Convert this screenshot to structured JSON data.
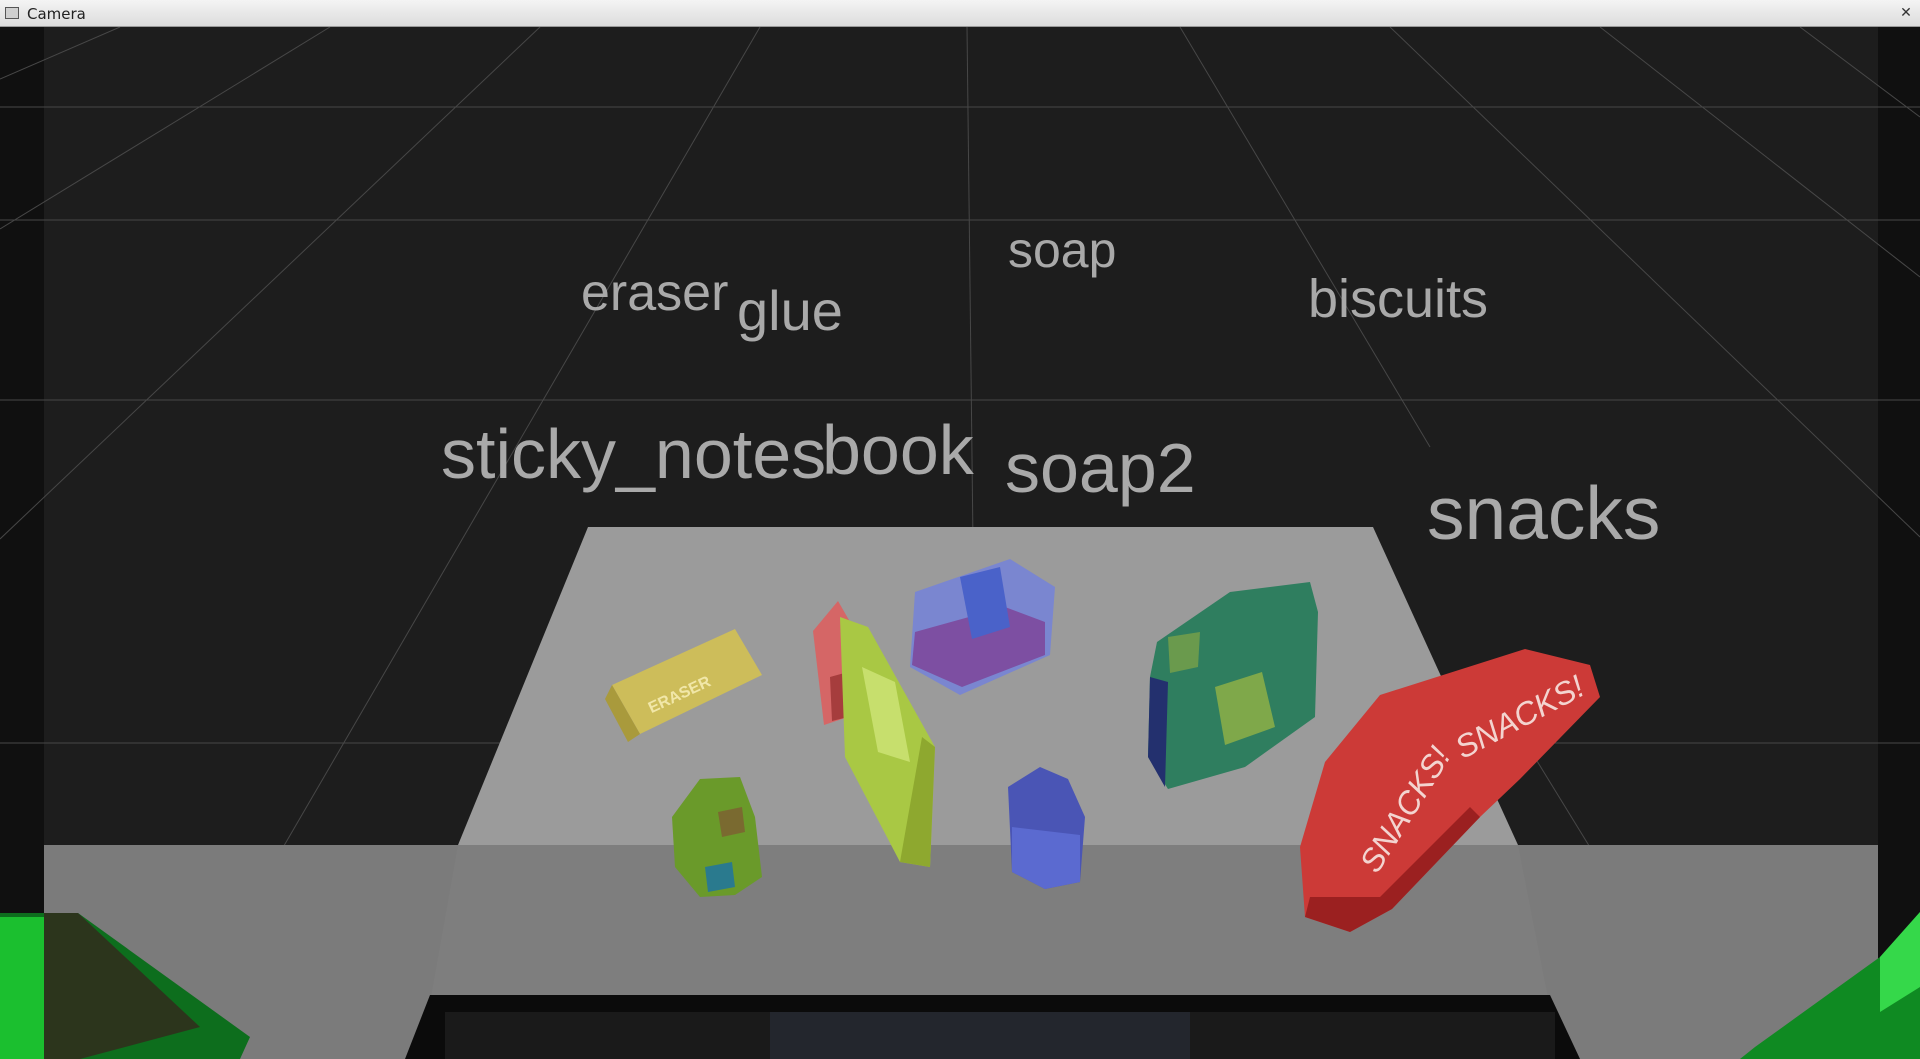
{
  "window": {
    "title": "Camera",
    "close_glyph": "✕",
    "icon": "camera-window-icon"
  },
  "scene": {
    "labels": [
      {
        "key": "eraser",
        "text": "eraser"
      },
      {
        "key": "glue",
        "text": "glue"
      },
      {
        "key": "soap",
        "text": "soap"
      },
      {
        "key": "biscuits",
        "text": "biscuits"
      },
      {
        "key": "sticky_notes",
        "text": "sticky_notes"
      },
      {
        "key": "book",
        "text": "book"
      },
      {
        "key": "soap2",
        "text": "soap2"
      },
      {
        "key": "snacks",
        "text": "snacks"
      }
    ],
    "packaging_text": {
      "eraser": "ERASER",
      "snacks_left": "SNACKS!",
      "snacks_right": "SNACKS!"
    },
    "colors": {
      "background": "#1d1d1d",
      "grid": "#4a4a4a",
      "table": "#7a7a7a",
      "label": "#a9a9a9"
    }
  }
}
